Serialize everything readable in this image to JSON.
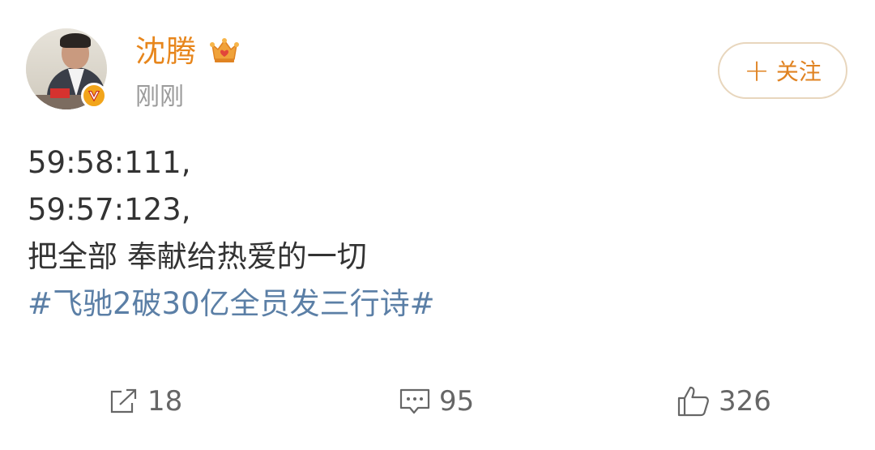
{
  "user": {
    "name": "沈腾",
    "timestamp": "刚刚",
    "follow_label": "关注",
    "follow_plus": "+"
  },
  "post": {
    "lines": [
      "59:58:111,",
      "59:57:123,",
      "把全部 奉献给热爱的一切"
    ],
    "hashtag": "#飞驰2破30亿全员发三行诗#"
  },
  "actions": {
    "repost_count": "18",
    "comment_count": "95",
    "like_count": "326"
  },
  "colors": {
    "username": "#e7861c",
    "hashtag": "#5b7fa6",
    "follow_text": "#e08322",
    "follow_border": "#e8d6bd",
    "verified_badge": "#f2a51b",
    "muted": "#9b9b9b"
  },
  "icons": {
    "vip": "crown-icon",
    "verified": "verified-v-icon",
    "repost": "share-arrow-icon",
    "comment": "comment-icon",
    "like": "thumbs-up-icon"
  }
}
